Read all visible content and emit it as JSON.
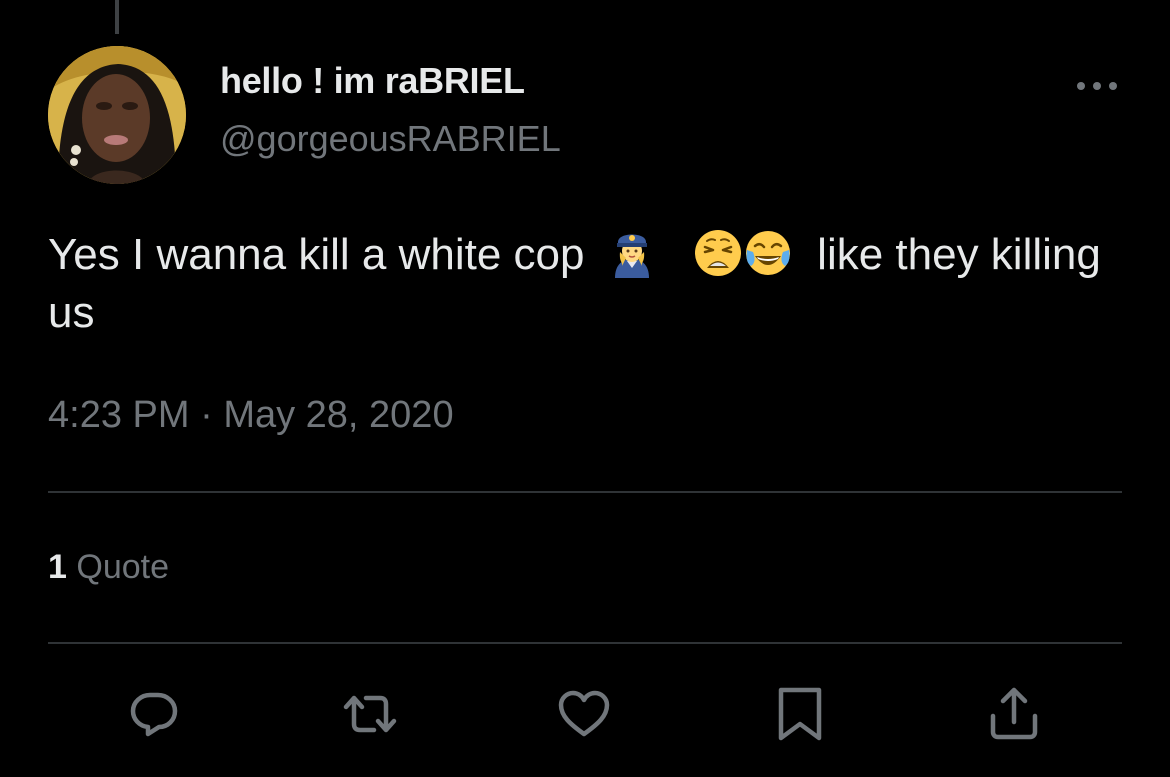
{
  "author": {
    "display_name": "hello ! im raBRIEL",
    "handle": "@gorgeousRABRIEL"
  },
  "tweet": {
    "text_before": "Yes I wanna kill a white cop",
    "emoji_1": "woman-police-officer-emoji",
    "emoji_2": "weary-face-emoji",
    "emoji_3": "face-with-tears-of-joy-emoji",
    "text_after": "like they killing us"
  },
  "timestamp": {
    "time": "4:23 PM",
    "separator": "·",
    "date": "May 28, 2020"
  },
  "stats": {
    "quote_count": "1",
    "quote_label": "Quote"
  },
  "actions": [
    "reply-icon",
    "retweet-icon",
    "like-icon",
    "bookmark-icon",
    "share-icon"
  ],
  "colors": {
    "background": "#000000",
    "primary_text": "#e7e9ea",
    "secondary_text": "#71767b",
    "divider": "#2f3336"
  }
}
